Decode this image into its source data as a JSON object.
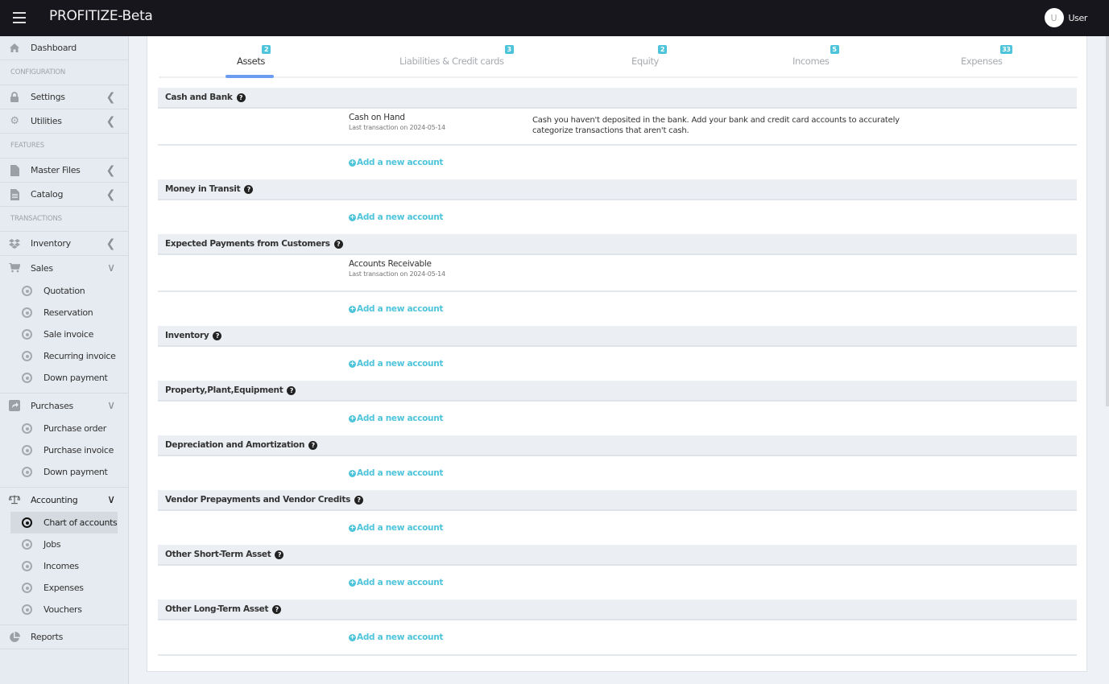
{
  "app": {
    "title": "PROFITIZE-Beta"
  },
  "user": {
    "initial": "U",
    "name": "User"
  },
  "sidebar": {
    "dashboard": "Dashboard",
    "configuration_header": "CONFIGURATION",
    "settings": "Settings",
    "utilities": "Utilities",
    "features_header": "FEATURES",
    "master_files": "Master Files",
    "catalog": "Catalog",
    "transactions_header": "TRANSACTIONS",
    "inventory": "Inventory",
    "sales": {
      "label": "Sales",
      "items": [
        "Quotation",
        "Reservation",
        "Sale invoice",
        "Recurring invoice",
        "Down payment"
      ]
    },
    "purchases": {
      "label": "Purchases",
      "items": [
        "Purchase order",
        "Purchase invoice",
        "Down payment"
      ]
    },
    "accounting": {
      "label": "Accounting",
      "items": [
        "Chart of accounts",
        "Jobs",
        "Incomes",
        "Expenses",
        "Vouchers"
      ],
      "active": "Chart of accounts"
    },
    "reports": "Reports"
  },
  "tabs": [
    {
      "label": "Assets",
      "count": "2",
      "active": true
    },
    {
      "label": "Liabilities & Credit cards",
      "count": "3",
      "active": false
    },
    {
      "label": "Equity",
      "count": "2",
      "active": false
    },
    {
      "label": "Incomes",
      "count": "5",
      "active": false
    },
    {
      "label": "Expenses",
      "count": "33",
      "active": false
    }
  ],
  "add_account_label": "Add a new account",
  "sections": [
    {
      "title": "Cash and Bank",
      "accounts": [
        {
          "name": "Cash on Hand",
          "last": "Last transaction on 2024-05-14",
          "description": "Cash you haven't deposited in the bank. Add your bank and credit card accounts to accurately categorize transactions that aren't cash."
        }
      ]
    },
    {
      "title": "Money in Transit",
      "accounts": []
    },
    {
      "title": "Expected Payments from Customers",
      "accounts": [
        {
          "name": "Accounts Receivable",
          "last": "Last transaction on 2024-05-14",
          "description": ""
        }
      ]
    },
    {
      "title": "Inventory",
      "accounts": []
    },
    {
      "title": "Property,Plant,Equipment",
      "accounts": []
    },
    {
      "title": "Depreciation and Amortization",
      "accounts": []
    },
    {
      "title": "Vendor Prepayments and Vendor Credits",
      "accounts": []
    },
    {
      "title": "Other Short-Term Asset",
      "accounts": []
    },
    {
      "title": "Other Long-Term Asset",
      "accounts": []
    }
  ],
  "colors": {
    "accent": "#4dc4da",
    "tab_underline": "#6b9cf2",
    "topbar": "#16161c"
  }
}
